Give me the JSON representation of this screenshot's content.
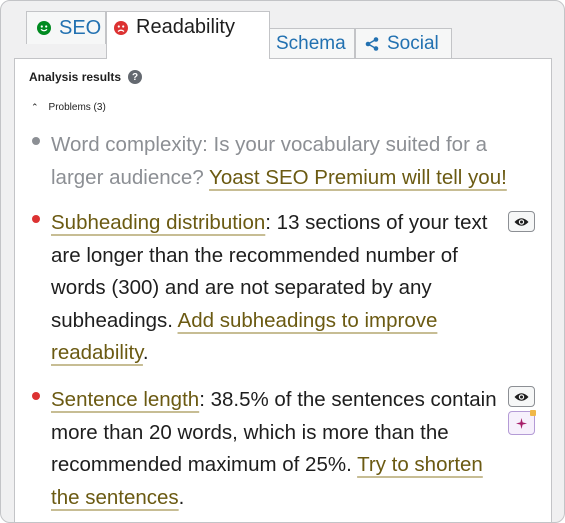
{
  "tabs": {
    "seo": "SEO",
    "readability": "Readability",
    "schema": "Schema",
    "social": "Social"
  },
  "panel": {
    "heading": "Analysis results",
    "help_glyph": "?",
    "problems_toggle": "Problems (3)"
  },
  "results": [
    {
      "status": "grey",
      "text": "Word complexity: Is your vocabulary suited for a larger audience? ",
      "link": "Yoast SEO Premium will tell you!"
    },
    {
      "status": "red",
      "title": "Subheading distribution",
      "text": ": 13 sections of your text are longer than the recommended number of words (300) and are not separated by any subheadings. ",
      "link": "Add subheadings to improve readability",
      "end": "."
    },
    {
      "status": "red",
      "title": "Sentence length",
      "text": ": 38.5% of the sentences contain more than 20 words, which is more than the recommended maximum of 25%. ",
      "link": "Try to shorten the sentences",
      "end": "."
    }
  ],
  "colors": {
    "red": "#dc3232",
    "grey": "#8c8f94",
    "link": "#6b5a12",
    "accent": "#2271b1",
    "seo_face": "#008a20",
    "readability_face": "#dc3232"
  },
  "icons": {
    "seo": "smiley-face-icon",
    "readability": "sad-face-icon",
    "schema": "grid-icon",
    "social": "share-icon",
    "highlight": "eye-icon",
    "ai_fix": "sparkle-icon"
  }
}
